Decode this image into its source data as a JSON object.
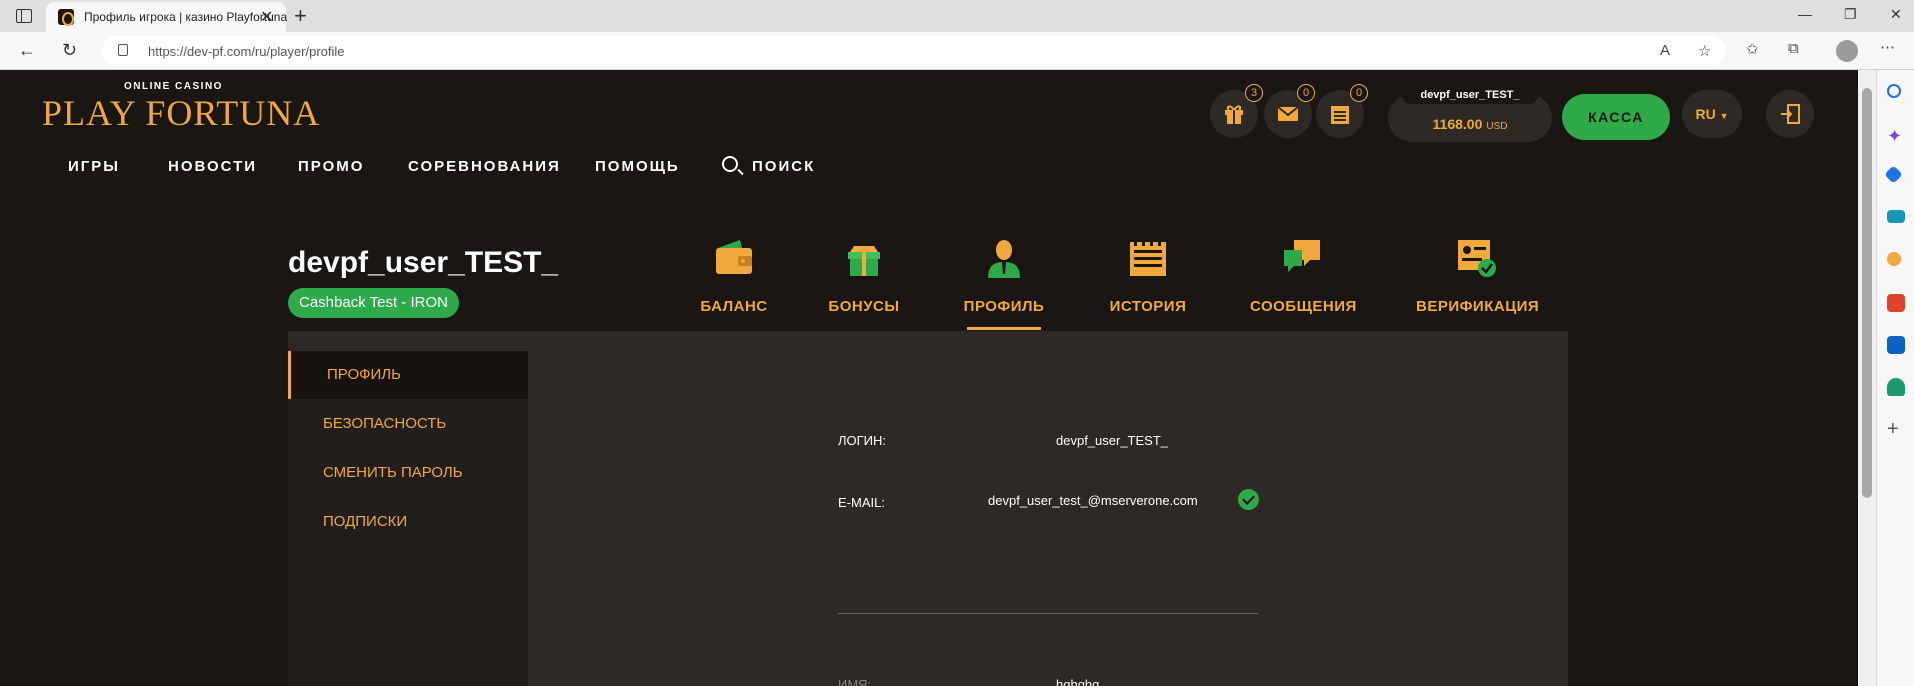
{
  "browser": {
    "tab_title": "Профиль игрока | казино Playfortuna",
    "url": "https://dev-pf.com/ru/player/profile"
  },
  "site": {
    "logo_top": "ONLINE CASINO",
    "logo_main": "PLAY FORTUNA",
    "nav": [
      "ИГРЫ",
      "НОВОСТИ",
      "ПРОМО",
      "СОРЕВНОВАНИЯ",
      "ПОМОЩЬ"
    ],
    "search_label": "ПОИСК",
    "badges": {
      "gifts": "3",
      "messages": "0",
      "notes": "0"
    },
    "balance_user": "devpf_user_TEST_",
    "balance_amount": "1168.00",
    "balance_currency": "USD",
    "cashier_label": "КАССА",
    "language": "RU"
  },
  "profile": {
    "username": "devpf_user_TEST_",
    "level": "Cashback Test - IRON",
    "tabs": [
      "БАЛАНС",
      "БОНУСЫ",
      "ПРОФИЛЬ",
      "ИСТОРИЯ",
      "СООБЩЕНИЯ",
      "ВЕРИФИКАЦИЯ"
    ],
    "active_tab": "ПРОФИЛЬ",
    "side_nav": [
      "ПРОФИЛЬ",
      "БЕЗОПАСНОСТЬ",
      "СМЕНИТЬ ПАРОЛЬ",
      "ПОДПИСКИ"
    ],
    "fields": {
      "login_label": "ЛОГИН:",
      "login_value": "devpf_user_TEST_",
      "email_label": "E-MAIL:",
      "email_value": "devpf_user_test_@mserverone.com",
      "name_label": "ИМЯ:",
      "name_value": "hghghg"
    }
  },
  "colors": {
    "accent": "#f0a93a",
    "green": "#2eaa4b",
    "bg": "#1a1613",
    "panel": "#2d2924"
  }
}
